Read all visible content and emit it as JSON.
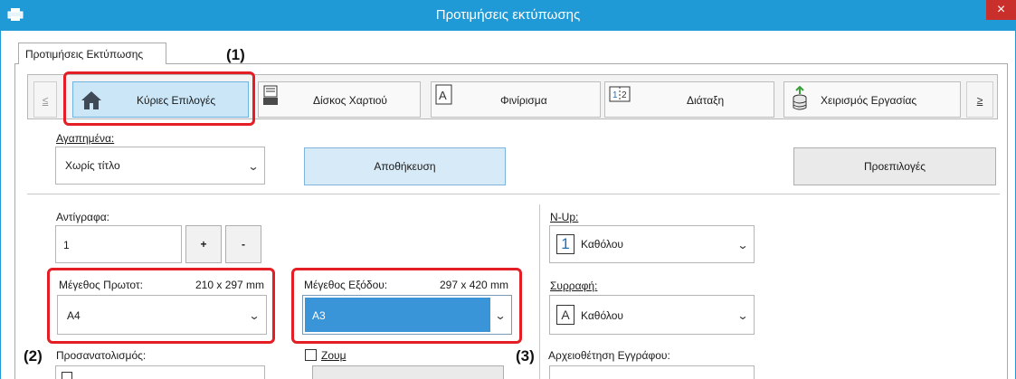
{
  "window": {
    "title": "Προτιμήσεις εκτύπωσης",
    "close_glyph": "×"
  },
  "tab": {
    "label": "Προτιμήσεις Εκτύπωσης"
  },
  "callouts": {
    "c1": "(1)",
    "c2": "(2)",
    "c3": "(3)"
  },
  "categories": {
    "prev": "≤",
    "next": "≥",
    "items": [
      {
        "label": "Κύριες Επιλογές",
        "icon": "home-icon",
        "active": true
      },
      {
        "label": "Δίσκος Χαρτιού",
        "icon": "paper-tray-icon",
        "active": false
      },
      {
        "label": "Φινίρισμα",
        "icon": "finishing-icon",
        "active": false
      },
      {
        "label": "Διάταξη",
        "icon": "layout-icon",
        "active": false
      },
      {
        "label": "Χειρισμός Εργασίας",
        "icon": "job-handling-icon",
        "active": false
      }
    ]
  },
  "favorites": {
    "label": "Αγαπημένα:",
    "value": "Χωρίς τίτλο",
    "save_label": "Αποθήκευση",
    "defaults_label": "Προεπιλογές"
  },
  "copies": {
    "label": "Αντίγραφα:",
    "value": "1",
    "plus": "+",
    "minus": "-"
  },
  "original_size": {
    "label": "Μέγεθος Πρωτοτ:",
    "dims": "210 x 297 mm",
    "value": "A4"
  },
  "output_size": {
    "label": "Μέγεθος Εξόδου:",
    "dims": "297 x 420 mm",
    "value": "A3"
  },
  "orientation": {
    "label": "Προσανατολισμός:"
  },
  "zoom": {
    "label": "Ζουμ",
    "checked": false
  },
  "nup": {
    "label": "N-Up:",
    "icon_digit": "1",
    "value": "Καθόλου"
  },
  "collate": {
    "label": "Συρραφή:",
    "icon_letter": "A",
    "value": "Καθόλου"
  },
  "document_filing": {
    "label": "Αρχειοθέτηση Εγγράφου:"
  },
  "colors": {
    "titlebar": "#1f9ad6",
    "highlight": "#e31e24",
    "selected_field": "#3a95d8"
  }
}
